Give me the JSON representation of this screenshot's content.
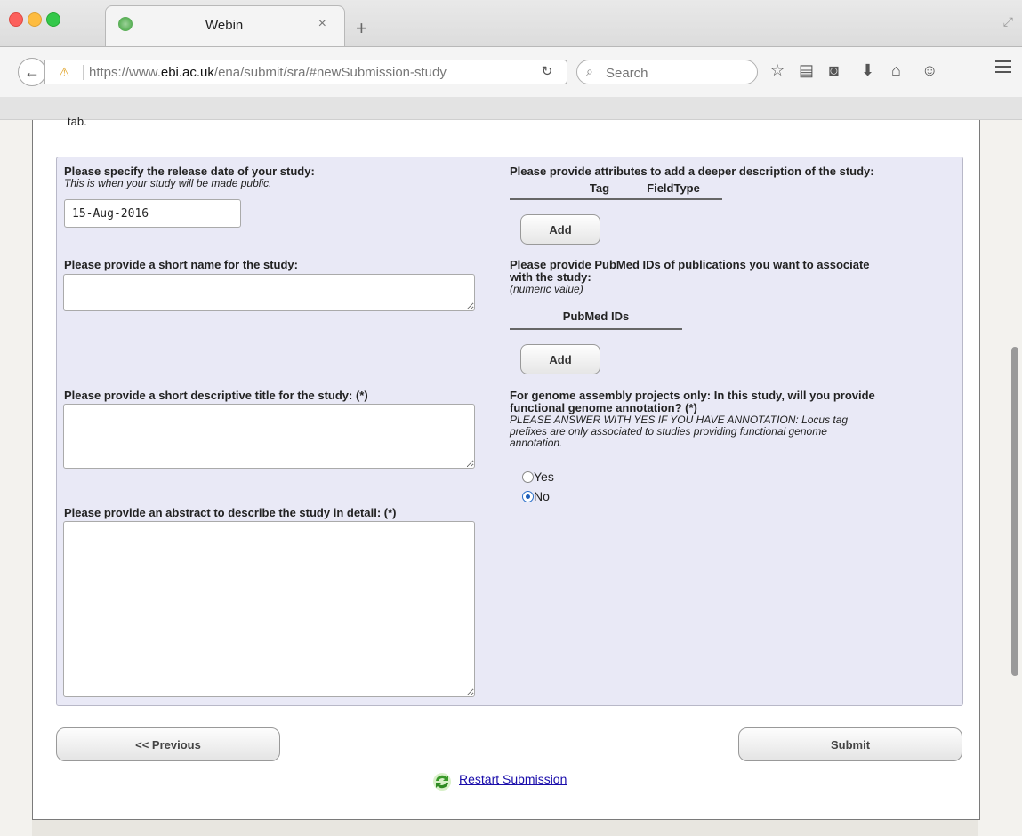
{
  "browser": {
    "tab_title": "Webin",
    "tab_close": "×",
    "new_tab": "+",
    "url_prefix": "https://www.",
    "url_domain": "ebi.ac.uk",
    "url_path": "/ena/submit/sra/#newSubmission-study",
    "search_placeholder": "Search",
    "icons": [
      "back-arrow-icon",
      "warning-lock-icon",
      "reload-icon",
      "search-icon",
      "star-icon",
      "reader-icon",
      "pocket-icon",
      "download-icon",
      "home-icon",
      "chat-icon",
      "menu-icon"
    ]
  },
  "page": {
    "cut_text": "tab.",
    "release": {
      "label": "Please specify the release date of your study:",
      "hint": "This is when your study will be made public.",
      "value": "15-Aug-2016"
    },
    "short_name": {
      "label": "Please provide a short name for the study:",
      "value": ""
    },
    "title": {
      "label": "Please provide a short descriptive title for the study: (*)",
      "value": ""
    },
    "abstract": {
      "label": "Please provide an abstract to describe the study in detail: (*)",
      "value": ""
    },
    "attributes": {
      "label": "Please provide attributes to add a deeper description of the study:",
      "columns": [
        "Tag",
        "FieldType"
      ],
      "add_label": "Add"
    },
    "pubmed": {
      "label_line1": "Please provide PubMed IDs of publications you want to associate",
      "label_line2": "with the study:",
      "hint": "(numeric value)",
      "column": "PubMed IDs",
      "add_label": "Add"
    },
    "annotation": {
      "label_line1": "For genome assembly projects only: In this study, will you provide",
      "label_line2": "functional genome annotation? (*)",
      "hint_line1": "PLEASE ANSWER WITH YES IF YOU HAVE ANNOTATION: Locus tag",
      "hint_line2": "prefixes are only associated to studies providing functional genome",
      "hint_line3": "annotation.",
      "options": [
        "Yes",
        "No"
      ],
      "selected": "No"
    },
    "previous_label": "<< Previous",
    "submit_label": "Submit",
    "restart_label": "Restart Submission"
  },
  "colors": {
    "panel_bg": "#e9e9f6",
    "link": "#1a0dab",
    "radio_selected": "#1e5fba"
  }
}
